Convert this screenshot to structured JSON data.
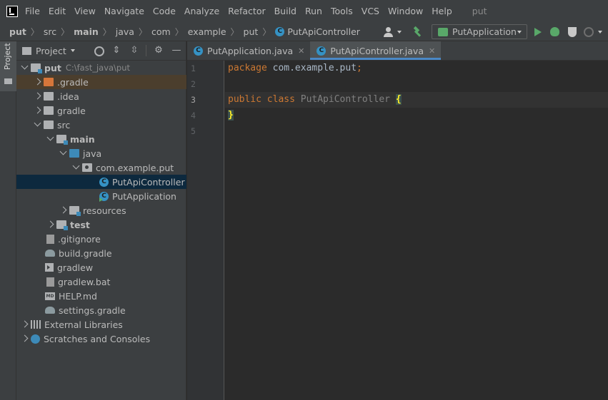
{
  "menubar": {
    "items": [
      "File",
      "Edit",
      "View",
      "Navigate",
      "Code",
      "Analyze",
      "Refactor",
      "Build",
      "Run",
      "Tools",
      "VCS",
      "Window",
      "Help"
    ],
    "project_title": "put"
  },
  "navbar": {
    "crumbs": [
      "put",
      "src",
      "main",
      "java",
      "com",
      "example",
      "put",
      "PutApiController"
    ],
    "run_config": "PutApplication"
  },
  "tool_strip": {
    "label": "Project"
  },
  "project_panel": {
    "title": "Project",
    "tree": [
      {
        "label": "put",
        "hint": "C:\\fast_java\\put"
      },
      {
        "label": ".gradle"
      },
      {
        "label": ".idea"
      },
      {
        "label": "gradle"
      },
      {
        "label": "src"
      },
      {
        "label": "main"
      },
      {
        "label": "java"
      },
      {
        "label": "com.example.put"
      },
      {
        "label": "PutApiController"
      },
      {
        "label": "PutApplication"
      },
      {
        "label": "resources"
      },
      {
        "label": "test"
      },
      {
        "label": ".gitignore"
      },
      {
        "label": "build.gradle"
      },
      {
        "label": "gradlew"
      },
      {
        "label": "gradlew.bat"
      },
      {
        "label": "HELP.md"
      },
      {
        "label": "settings.gradle"
      },
      {
        "label": "External Libraries"
      },
      {
        "label": "Scratches and Consoles"
      }
    ]
  },
  "editor": {
    "tabs": [
      {
        "label": "PutApplication.java"
      },
      {
        "label": "PutApiController.java"
      }
    ],
    "line_numbers": [
      "1",
      "2",
      "3",
      "4",
      "5"
    ],
    "code": {
      "line1_kw": "package",
      "line1_txt": " com.example.put",
      "line1_semi": ";",
      "line3_kw": "public class",
      "line3_cls": " PutApiController ",
      "line3_brace": "{",
      "line4_brace": "}"
    }
  },
  "colors": {
    "background": "#2b2b2b",
    "panel": "#3c3f41",
    "keyword": "#cc7832",
    "accent": "#4a88c7",
    "run_green": "#59a869"
  }
}
